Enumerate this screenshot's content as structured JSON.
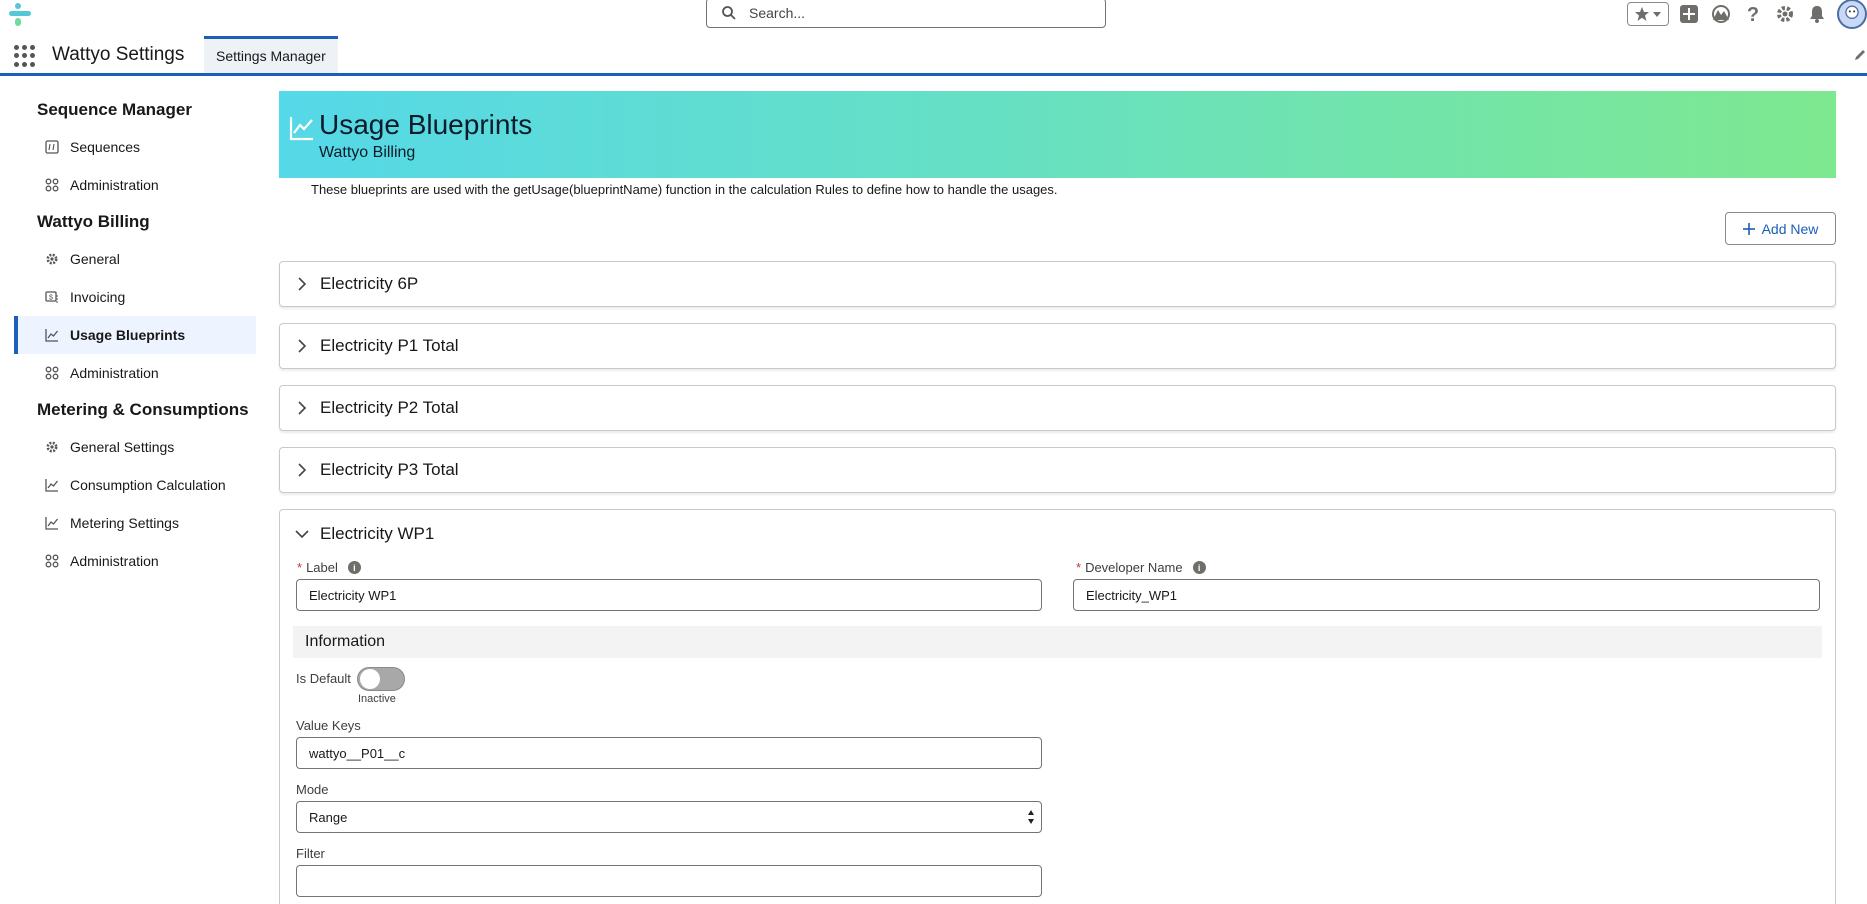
{
  "header": {
    "search_placeholder": "Search...",
    "icons": [
      "favorites-star-icon",
      "add-icon",
      "trailhead-icon",
      "help-icon",
      "setup-gear-icon",
      "notifications-bell-icon",
      "user-avatar"
    ]
  },
  "app_nav": {
    "app_name": "Wattyo Settings",
    "tab_label": "Settings Manager"
  },
  "sidebar": {
    "sections": [
      {
        "title": "Sequence Manager",
        "items": [
          {
            "label": "Sequences",
            "icon": "hash-icon"
          },
          {
            "label": "Administration",
            "icon": "apps-icon"
          }
        ]
      },
      {
        "title": "Wattyo Billing",
        "items": [
          {
            "label": "General",
            "icon": "gear-icon"
          },
          {
            "label": "Invoicing",
            "icon": "invoice-icon"
          },
          {
            "label": "Usage Blueprints",
            "icon": "chart-line-icon",
            "active": true
          },
          {
            "label": "Administration",
            "icon": "apps-icon"
          }
        ]
      },
      {
        "title": "Metering & Consumptions",
        "items": [
          {
            "label": "General Settings",
            "icon": "gear-icon"
          },
          {
            "label": "Consumption Calculation",
            "icon": "chart-line-icon"
          },
          {
            "label": "Metering Settings",
            "icon": "chart-line-icon"
          },
          {
            "label": "Administration",
            "icon": "apps-icon"
          }
        ]
      }
    ]
  },
  "main": {
    "title": "Usage Blueprints",
    "subtitle": "Wattyo Billing",
    "description": "These blueprints are used with the getUsage(blueprintName) function in the calculation Rules to define how to handle the usages.",
    "add_button_label": "Add New",
    "accordions": [
      {
        "label": "Electricity 6P",
        "expanded": false
      },
      {
        "label": "Electricity P1 Total",
        "expanded": false
      },
      {
        "label": "Electricity P2 Total",
        "expanded": false
      },
      {
        "label": "Electricity P3 Total",
        "expanded": false
      },
      {
        "label": "Electricity WP1",
        "expanded": true
      }
    ],
    "form": {
      "label_field": {
        "label": "Label",
        "value": "Electricity WP1"
      },
      "developer_name_field": {
        "label": "Developer Name",
        "value": "Electricity_WP1"
      },
      "section_title": "Information",
      "is_default": {
        "label": "Is Default",
        "state": "Inactive"
      },
      "value_keys": {
        "label": "Value Keys",
        "value": "wattyo__P01__c"
      },
      "mode": {
        "label": "Mode",
        "value": "Range"
      },
      "filter": {
        "label": "Filter",
        "value": ""
      }
    }
  },
  "colors": {
    "brand_blue": "#1b5fb8",
    "banner_start": "#55d8e8",
    "banner_end": "#7ee890",
    "required_red": "#c23934"
  }
}
